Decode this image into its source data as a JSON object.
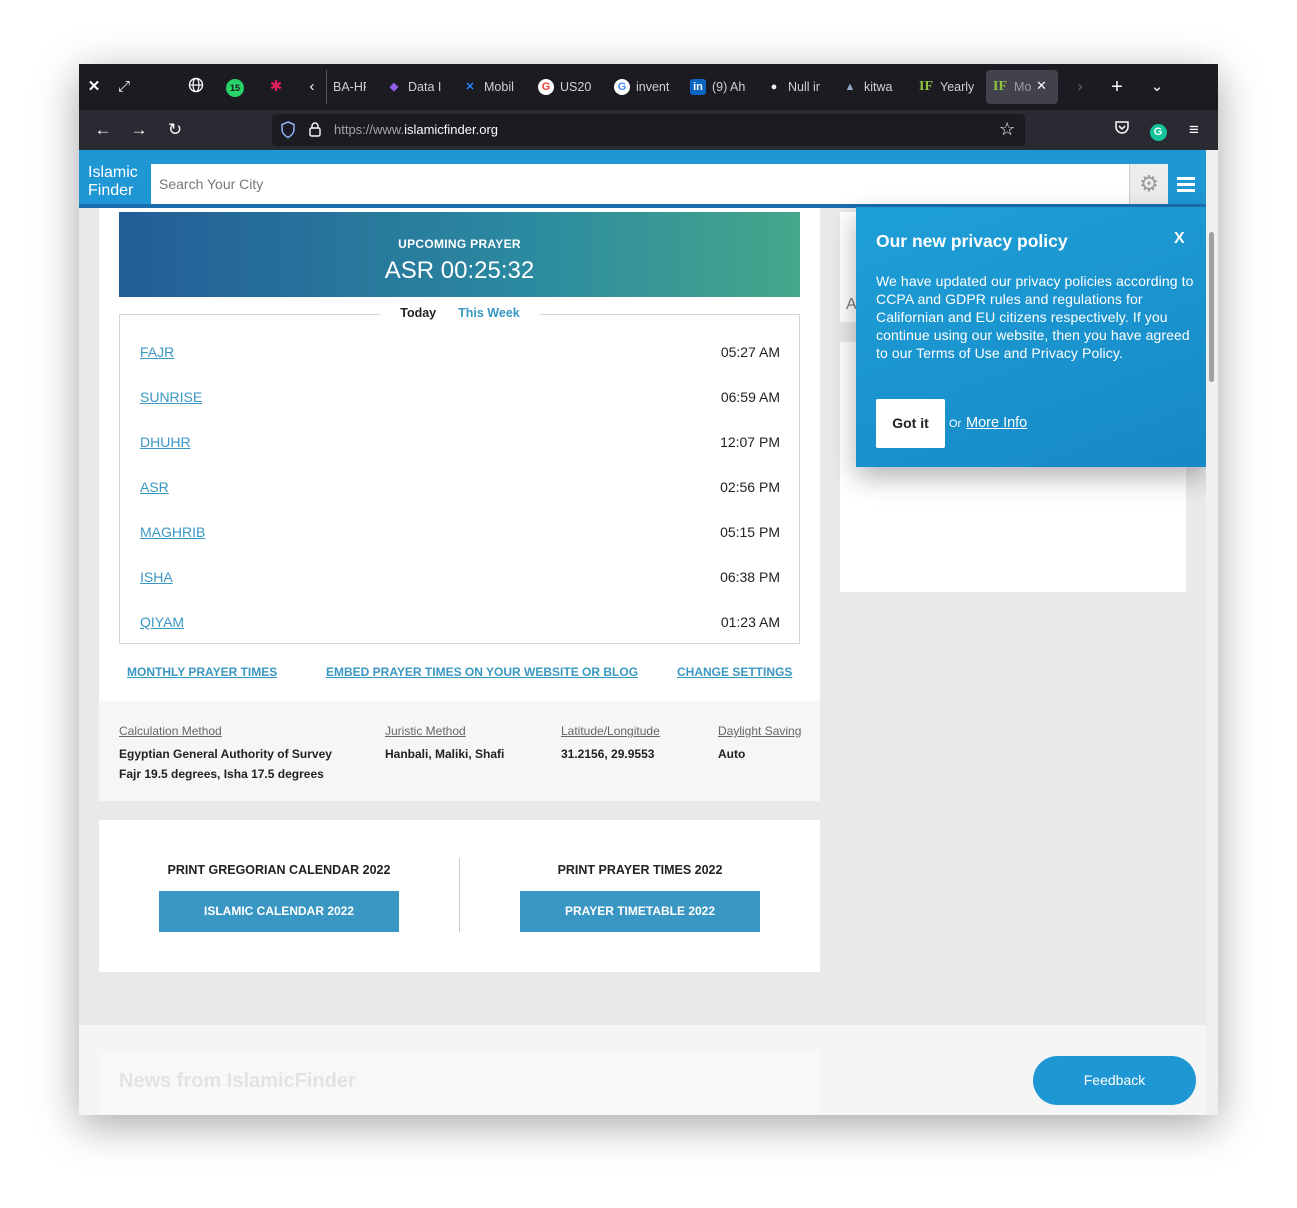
{
  "browser": {
    "tabs": [
      {
        "label": "BA-HF",
        "fav": ""
      },
      {
        "label": "Data I",
        "fav": "◆"
      },
      {
        "label": "Mobil",
        "fav": "✕"
      },
      {
        "label": "US20",
        "fav": "G"
      },
      {
        "label": "invent",
        "fav": "G"
      },
      {
        "label": "(9) Ah",
        "fav": "in"
      },
      {
        "label": "Null ir",
        "fav": "●"
      },
      {
        "label": "kitwa",
        "fav": "▲"
      },
      {
        "label": "Yearly",
        "fav": "IF"
      },
      {
        "label": "Mo",
        "fav": "IF"
      }
    ],
    "badge_count": "15",
    "url_prefix": "https://www.",
    "url_domain": "islamicfinder.org"
  },
  "header": {
    "logo_line1": "Islamic",
    "logo_line2": "Finder",
    "search_placeholder": "Search Your City"
  },
  "upcoming": {
    "label": "UPCOMING PRAYER",
    "time": "ASR 00:25:32"
  },
  "prayer_tabs": {
    "today": "Today",
    "week": "This Week"
  },
  "prayers": [
    {
      "name": "FAJR",
      "time": "05:27 AM"
    },
    {
      "name": "SUNRISE",
      "time": "06:59 AM"
    },
    {
      "name": "DHUHR",
      "time": "12:07 PM"
    },
    {
      "name": "ASR",
      "time": "02:56 PM"
    },
    {
      "name": "MAGHRIB",
      "time": "05:15 PM"
    },
    {
      "name": "ISHA",
      "time": "06:38 PM"
    },
    {
      "name": "QIYAM",
      "time": "01:23 AM"
    }
  ],
  "links": {
    "monthly": "MONTHLY PRAYER TIMES",
    "embed": "EMBED PRAYER TIMES ON YOUR WEBSITE OR BLOG",
    "settings": "CHANGE SETTINGS"
  },
  "info": {
    "calc_label": "Calculation Method",
    "calc_value1": "Egyptian General Authority of Survey",
    "calc_value2": "Fajr 19.5 degrees, Isha 17.5 degrees",
    "juristic_label": "Juristic Method",
    "juristic_value": "Hanbali, Maliki, Shafi",
    "latlong_label": "Latitude/Longitude",
    "latlong_value": "31.2156, 29.9553",
    "dst_label": "Daylight Saving",
    "dst_value": "Auto"
  },
  "print": {
    "greg_title": "PRINT GREGORIAN CALENDAR  2022",
    "greg_button": "ISLAMIC CALENDAR  2022",
    "prayer_title": "PRINT PRAYER TIMES  2022",
    "prayer_button": "PRAYER TIMETABLE  2022"
  },
  "news_title": "News from IslamicFinder",
  "right_card_letter": "A",
  "feedback": "Feedback",
  "privacy": {
    "title": "Our new privacy policy",
    "close": "X",
    "body": "We have updated our privacy policies according to CCPA and GDPR rules and regulations for Californian and EU citizens respectively. If you continue using our website, then you have agreed to our Terms of Use and Privacy Policy.",
    "got_it": "Got it",
    "or": "Or",
    "more_info": "More Info"
  }
}
